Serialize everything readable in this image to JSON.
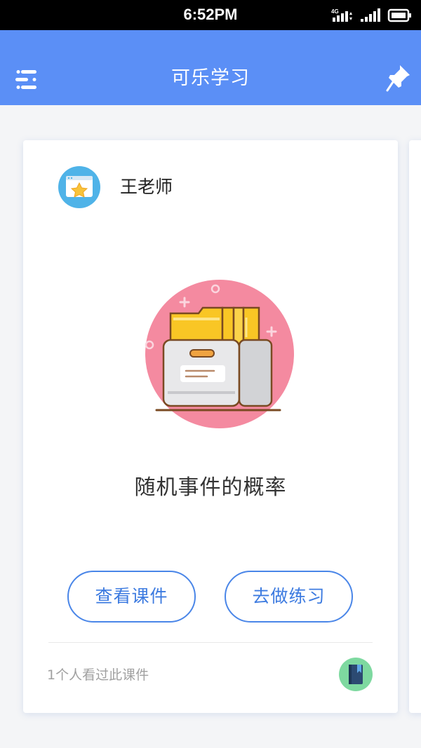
{
  "status_bar": {
    "time": "6:52PM",
    "network": "4G"
  },
  "app_bar": {
    "title": "可乐学习",
    "menu_icon": "menu-icon",
    "pin_icon": "pin-icon"
  },
  "course_card": {
    "teacher_name": "王老师",
    "course_title": "随机事件的概率",
    "view_courseware_label": "查看课件",
    "do_practice_label": "去做练习",
    "view_count_text": "1个人看过此课件",
    "badge_icon": "book-icon"
  },
  "colors": {
    "primary": "#5b8ff6",
    "button_border": "#4a86e8",
    "illustration_circle": "#f48aa0",
    "badge_bg": "#7ed9a0"
  }
}
